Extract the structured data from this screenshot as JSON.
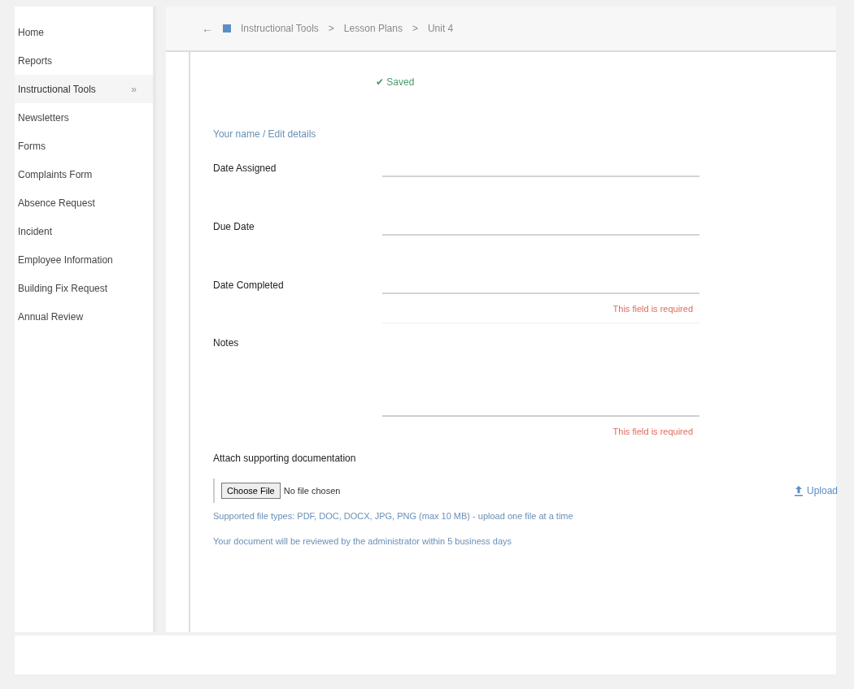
{
  "sidebar": {
    "items": [
      {
        "label": "Home",
        "selected": false
      },
      {
        "label": "Reports",
        "selected": false
      },
      {
        "label": "Instructional Tools",
        "selected": true,
        "expander": "»"
      },
      {
        "label": "Newsletters",
        "selected": false
      },
      {
        "label": "Forms",
        "selected": false
      },
      {
        "label": "Complaints Form",
        "selected": false
      },
      {
        "label": "Absence Request",
        "selected": false
      },
      {
        "label": "Incident",
        "selected": false
      },
      {
        "label": "Employee Information",
        "selected": false
      },
      {
        "label": "Building Fix Request",
        "selected": false
      },
      {
        "label": "Annual Review",
        "selected": false
      }
    ]
  },
  "breadcrumb": {
    "back": "←",
    "items": [
      "Instructional Tools",
      "Lesson Plans",
      "Unit 4"
    ],
    "separator": ">"
  },
  "form": {
    "status": "✔ Saved",
    "intro_link": "Your name / Edit details",
    "fields": [
      {
        "label": "Date Assigned",
        "kind": "line"
      },
      {
        "label": "Due Date",
        "kind": "line"
      },
      {
        "label": "Date Completed",
        "kind": "line",
        "error": "This field is required"
      },
      {
        "label": "Notes",
        "kind": "area",
        "error": "This field is required"
      }
    ],
    "attachment_label": "Attach supporting documentation",
    "file_button": "Choose File",
    "file_status": "No file chosen",
    "upload": "Upload",
    "help_lines": [
      "Supported file types: PDF, DOC, DOCX, JPG, PNG (max 10 MB) - upload one file at a time",
      "Your document will be reviewed by the administrator within 5 business days"
    ]
  }
}
